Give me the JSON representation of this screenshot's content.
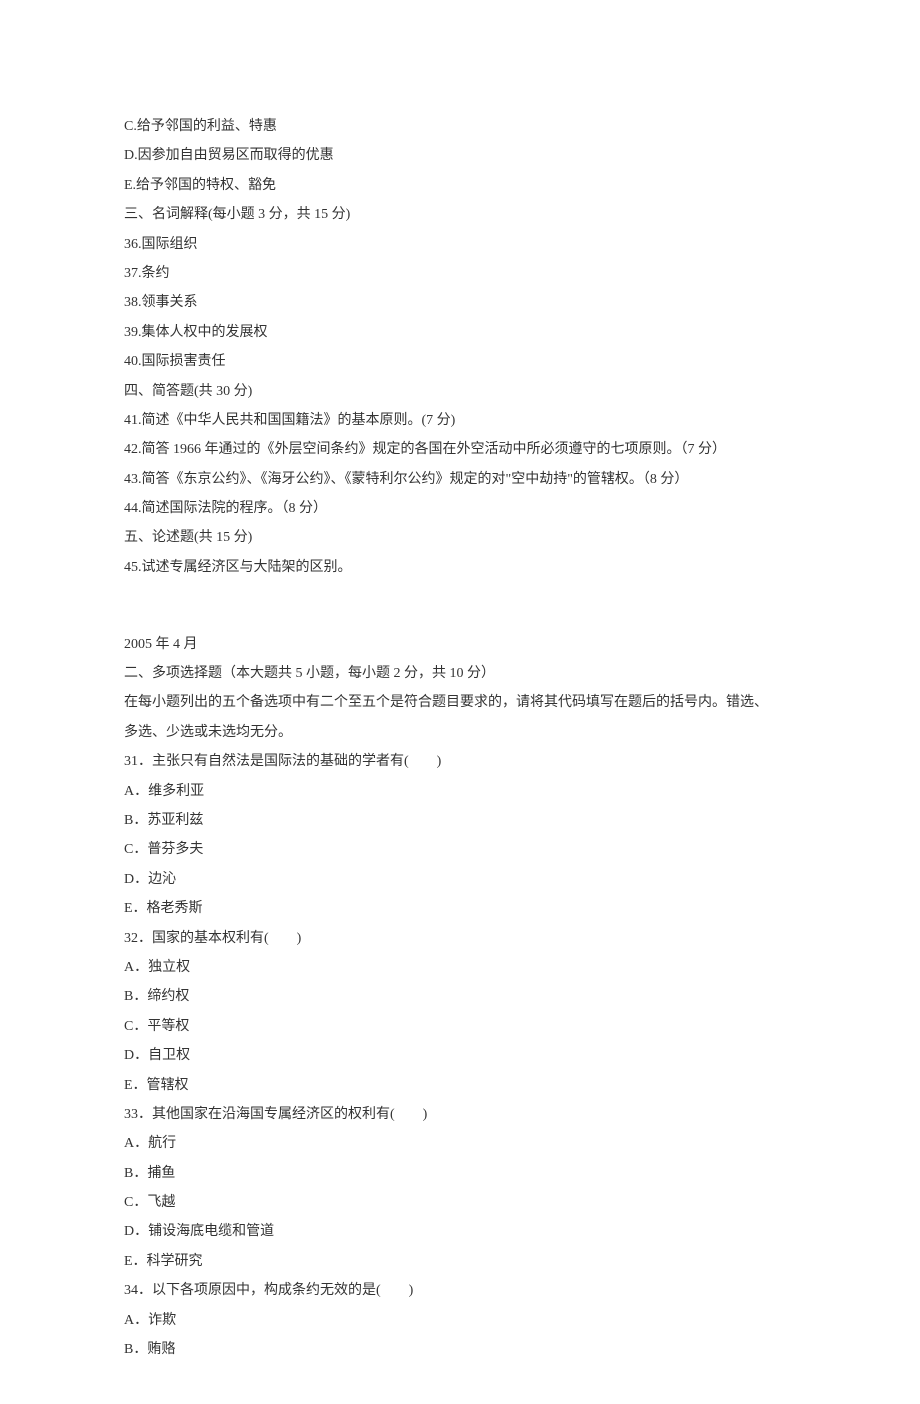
{
  "lines": [
    "C.给予邻国的利益、特惠",
    "D.因参加自由贸易区而取得的优惠",
    "E.给予邻国的特权、豁免",
    "三、名词解释(每小题 3 分，共 15 分)",
    "36.国际组织",
    "37.条约",
    "38.领事关系",
    "39.集体人权中的发展权",
    "40.国际损害责任",
    "四、简答题(共 30 分)",
    "41.简述《中华人民共和国国籍法》的基本原则。(7 分)",
    "42.简答 1966 年通过的《外层空间条约》规定的各国在外空活动中所必须遵守的七项原则。（7 分）",
    "43.简答《东京公约》、《海牙公约》、《蒙特利尔公约》规定的对\"空中劫持\"的管辖权。（8 分）",
    "44.简述国际法院的程序。（8 分）",
    "五、论述题(共 15 分)",
    "45.试述专属经济区与大陆架的区别。",
    "",
    "2005 年 4 月",
    "二、多项选择题（本大题共 5 小题，每小题 2 分，共 10 分）",
    "在每小题列出的五个备选项中有二个至五个是符合题目要求的，请将其代码填写在题后的括号内。错选、",
    "多选、少选或未选均无分。",
    "31．主张只有自然法是国际法的基础的学者有(　　)",
    "A．维多利亚",
    "B．苏亚利兹",
    "C．普芬多夫",
    "D．边沁",
    "E．格老秀斯",
    "32．国家的基本权利有(　　)",
    "A．独立权",
    "B．缔约权",
    "C．平等权",
    "D．自卫权",
    "E．管辖权",
    "33．其他国家在沿海国专属经济区的权利有(　　)",
    "A．航行",
    "B．捕鱼",
    "C．飞越",
    "D．铺设海底电缆和管道",
    "E．科学研究",
    "34．以下各项原因中，构成条约无效的是(　　)",
    "A．诈欺",
    "B．贿赂"
  ]
}
